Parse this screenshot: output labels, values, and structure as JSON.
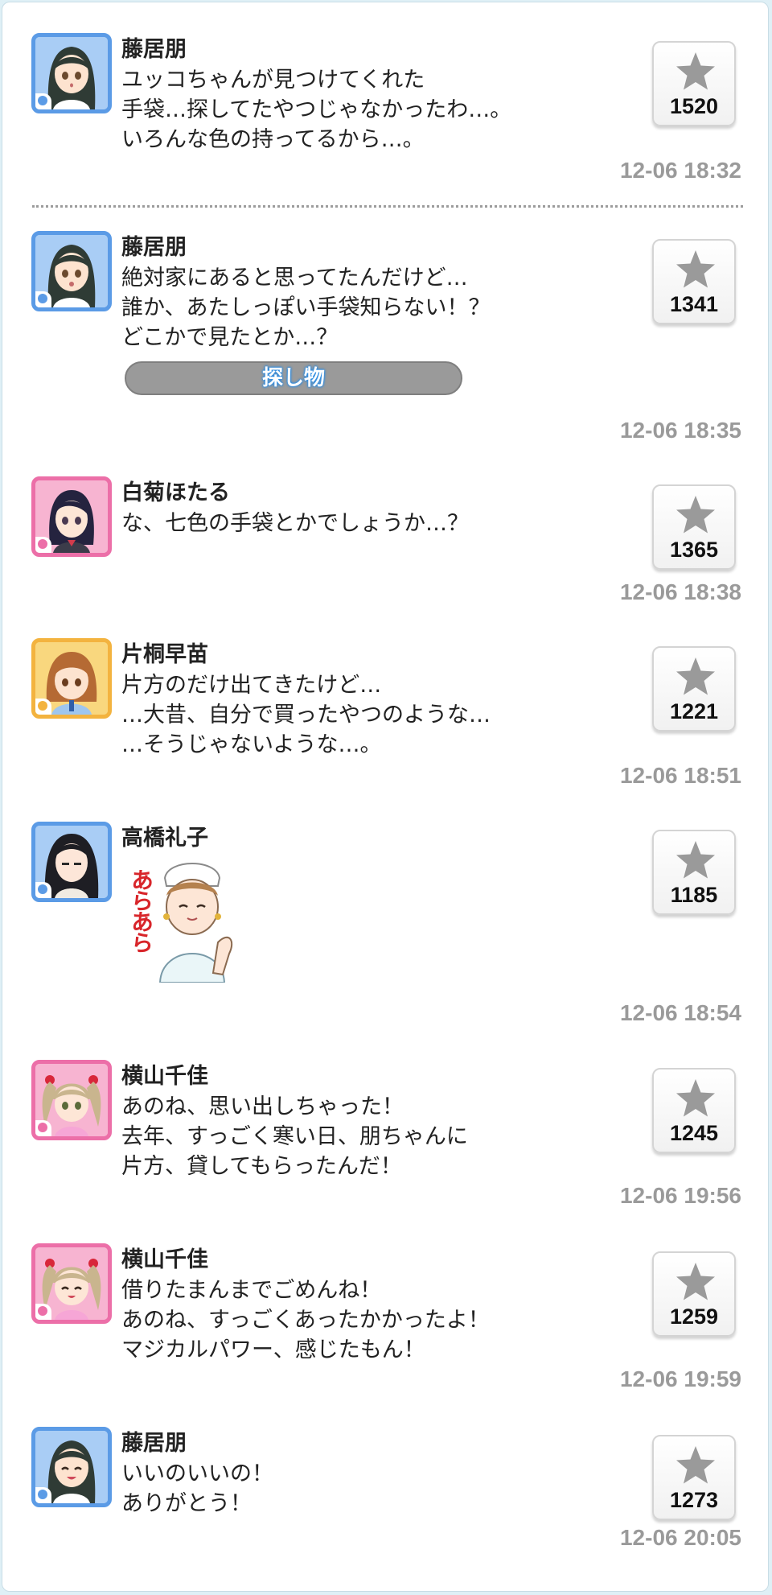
{
  "posts": [
    {
      "name": "藤居朋",
      "lines": [
        "ユッコちゃんが見つけてくれた",
        "手袋…探してたやつじゃなかったわ…。",
        "いろんな色の持ってるから…。"
      ],
      "likes": "1520",
      "timestamp": "12-06 18:32",
      "avatar": "tomo-avatar",
      "frame_color": "#5b9be6"
    },
    {
      "name": "藤居朋",
      "lines": [
        "絶対家にあると思ってたんだけど…",
        "誰か、あたしっぽい手袋知らない！？",
        "どこかで見たとか…？"
      ],
      "tag": "探し物",
      "likes": "1341",
      "timestamp": "12-06 18:35",
      "avatar": "tomo-avatar",
      "frame_color": "#5b9be6"
    },
    {
      "name": "白菊ほたる",
      "lines": [
        "な、七色の手袋とかでしょうか…？"
      ],
      "likes": "1365",
      "timestamp": "12-06 18:38",
      "avatar": "hotaru-avatar",
      "frame_color": "#ec6fa8"
    },
    {
      "name": "片桐早苗",
      "lines": [
        "片方のだけ出てきたけど…",
        "…大昔、自分で買ったやつのような…",
        "…そうじゃないような…。"
      ],
      "likes": "1221",
      "timestamp": "12-06 18:51",
      "avatar": "sanae-avatar",
      "frame_color": "#f3b33f"
    },
    {
      "name": "高橋礼子",
      "sticker_text": "あらあら",
      "sticker": "nurse-sticker",
      "likes": "1185",
      "timestamp": "12-06 18:54",
      "avatar": "reiko-avatar",
      "frame_color": "#5b9be6"
    },
    {
      "name": "横山千佳",
      "lines": [
        "あのね、思い出しちゃった！",
        "去年、すっごく寒い日、朋ちゃんに",
        "片方、貸してもらったんだ！"
      ],
      "likes": "1245",
      "timestamp": "12-06 19:56",
      "avatar": "chika-avatar",
      "frame_color": "#ec6fa8"
    },
    {
      "name": "横山千佳",
      "lines": [
        "借りたまんまでごめんね！",
        "あのね、すっごくあったかかったよ！",
        "マジカルパワー、感じたもん！"
      ],
      "likes": "1259",
      "timestamp": "12-06 19:59",
      "avatar": "chika-avatar",
      "frame_color": "#ec6fa8"
    },
    {
      "name": "藤居朋",
      "lines": [
        "いいのいいの！",
        "ありがとう！"
      ],
      "likes": "1273",
      "timestamp": "12-06 20:05",
      "avatar": "tomo-avatar",
      "frame_color": "#5b9be6"
    }
  ],
  "icons": {
    "like": "star-icon"
  },
  "colors": {
    "timestamp": "#9a9a9a",
    "star": "#9a9a9a",
    "tag_bg": "#9a9a9a"
  }
}
